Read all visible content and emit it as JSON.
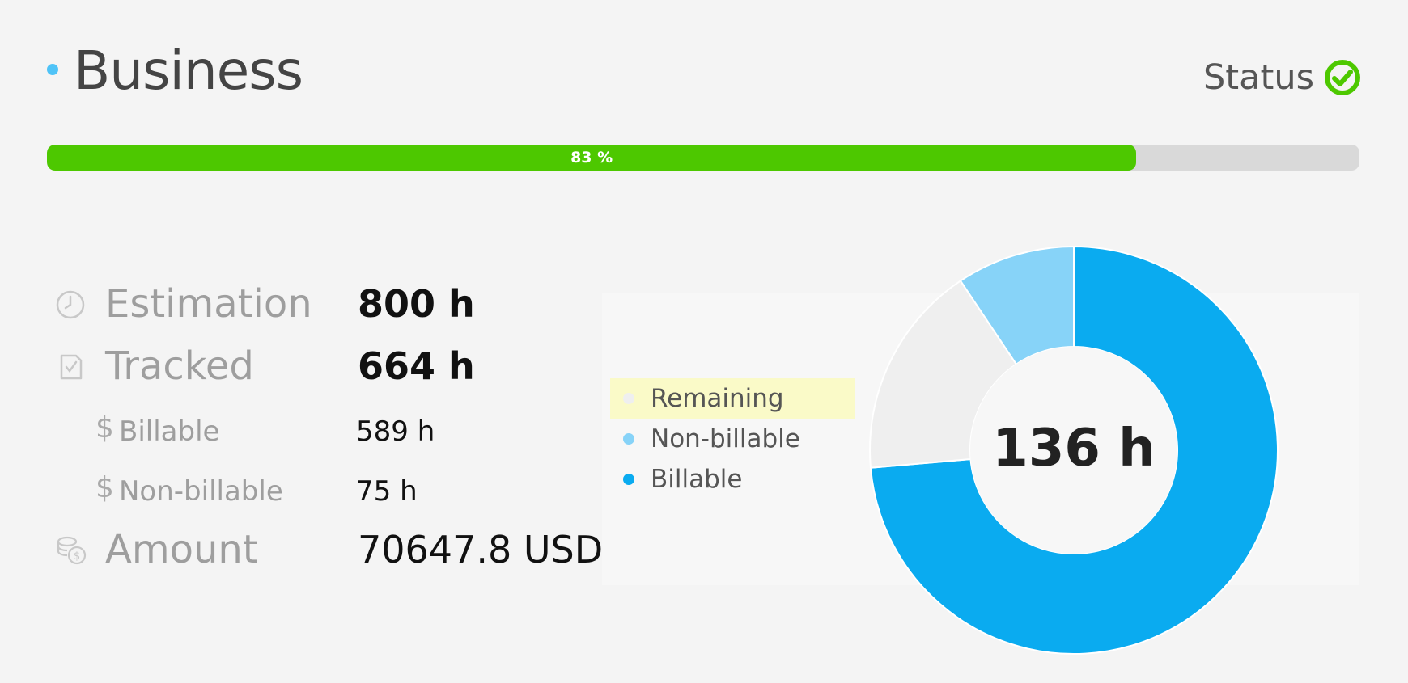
{
  "header": {
    "title": "Business",
    "status_label": "Status",
    "status_icon": "check-circle-icon",
    "status_color": "#4dc800",
    "title_dot_color": "#4fc3f7"
  },
  "progress": {
    "percent": 83,
    "label": "83 %",
    "fill_color": "#4dc800"
  },
  "stats": {
    "estimation": {
      "label": "Estimation",
      "value": "800 h",
      "icon": "clock-icon"
    },
    "tracked": {
      "label": "Tracked",
      "value": "664 h",
      "icon": "tracked-doc-icon"
    },
    "billable": {
      "symbol": "$",
      "label": "Billable",
      "value": "589 h"
    },
    "nonbillable": {
      "symbol": "$",
      "label": "Non-billable",
      "value": "75 h"
    },
    "amount": {
      "label": "Amount",
      "value": "70647.8 USD",
      "icon": "coins-icon"
    }
  },
  "chart_data": {
    "type": "pie",
    "center_label": "136 h",
    "series": [
      {
        "name": "Remaining",
        "value": 136,
        "color": "#efefef"
      },
      {
        "name": "Non-billable",
        "value": 75,
        "color": "#87d3f8"
      },
      {
        "name": "Billable",
        "value": 589,
        "color": "#0aabf0"
      }
    ],
    "legend": [
      "Remaining",
      "Non-billable",
      "Billable"
    ],
    "legend_position": "left",
    "highlighted": "Remaining"
  }
}
